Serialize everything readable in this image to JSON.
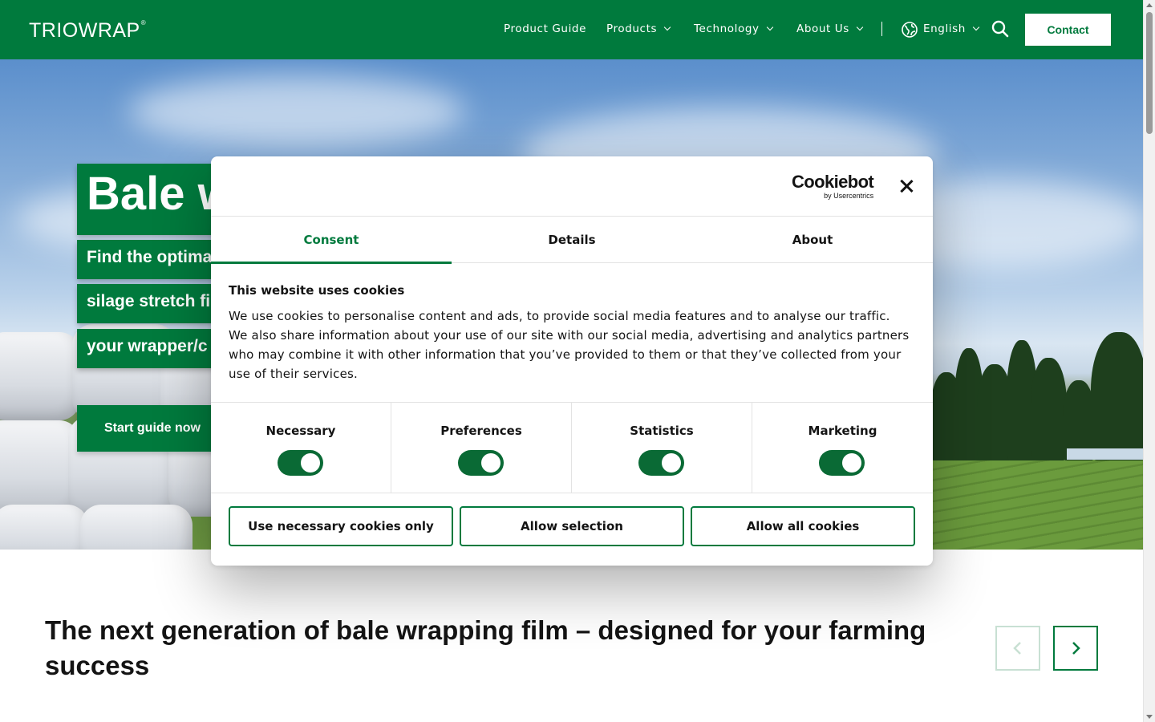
{
  "header": {
    "logo": "TRIOWRAP",
    "logo_mark": "®",
    "nav": [
      {
        "label": "Product Guide",
        "has_dropdown": false
      },
      {
        "label": "Products",
        "has_dropdown": true
      },
      {
        "label": "Technology",
        "has_dropdown": true
      },
      {
        "label": "About Us",
        "has_dropdown": true
      }
    ],
    "language": "English",
    "contact_label": "Contact",
    "icons": [
      "globe-icon",
      "search-icon",
      "chevron-down-icon"
    ]
  },
  "hero": {
    "title": "Bale w",
    "lines": [
      "Find the optima",
      "silage stretch fi",
      "your wrapper/c"
    ],
    "cta_label": "Start guide now"
  },
  "section": {
    "tagline": "The next generation of bale wrapping film – designed for your farming success"
  },
  "cookie_dialog": {
    "brand": "Cookiebot",
    "brand_sub": "by Usercentrics",
    "tabs": [
      "Consent",
      "Details",
      "About"
    ],
    "active_tab": "Consent",
    "title": "This website uses cookies",
    "text": "We use cookies to personalise content and ads, to provide social media features and to analyse our traffic. We also share information about your use of our site with our social media, advertising and analytics partners who may combine it with other information that you’ve provided to them or that they’ve collected from your use of their services.",
    "categories": [
      {
        "label": "Necessary",
        "enabled": true
      },
      {
        "label": "Preferences",
        "enabled": true
      },
      {
        "label": "Statistics",
        "enabled": true
      },
      {
        "label": "Marketing",
        "enabled": true
      }
    ],
    "buttons": [
      "Use necessary cookies only",
      "Allow selection",
      "Allow all cookies"
    ]
  },
  "colors": {
    "brand_green": "#007a3d",
    "toggle_green": "#0a6a35",
    "text": "#141414"
  }
}
